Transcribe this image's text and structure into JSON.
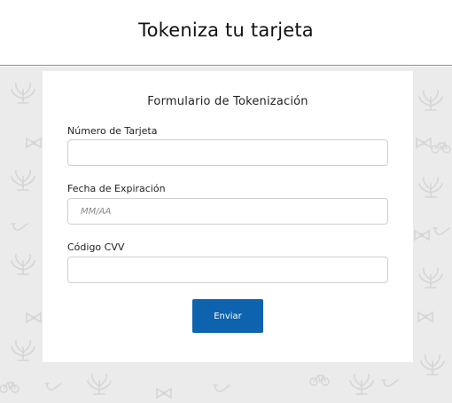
{
  "page": {
    "title": "Tokeniza tu tarjeta"
  },
  "form": {
    "title": "Formulario de Tokenización",
    "card_number": {
      "label": "Número de Tarjeta",
      "value": "",
      "placeholder": ""
    },
    "expiry": {
      "label": "Fecha de Expiración",
      "value": "",
      "placeholder": "MM/AA"
    },
    "cvv": {
      "label": "Código CVV",
      "value": "",
      "placeholder": ""
    },
    "submit_label": "Enviar"
  },
  "colors": {
    "button": "#0d63ad",
    "background": "#ebebeb",
    "pattern_icons": "#d8d8d8"
  },
  "background_pattern_icons": [
    "plant-icon",
    "bow-icon",
    "bicycle-icon",
    "pipe-icon"
  ]
}
